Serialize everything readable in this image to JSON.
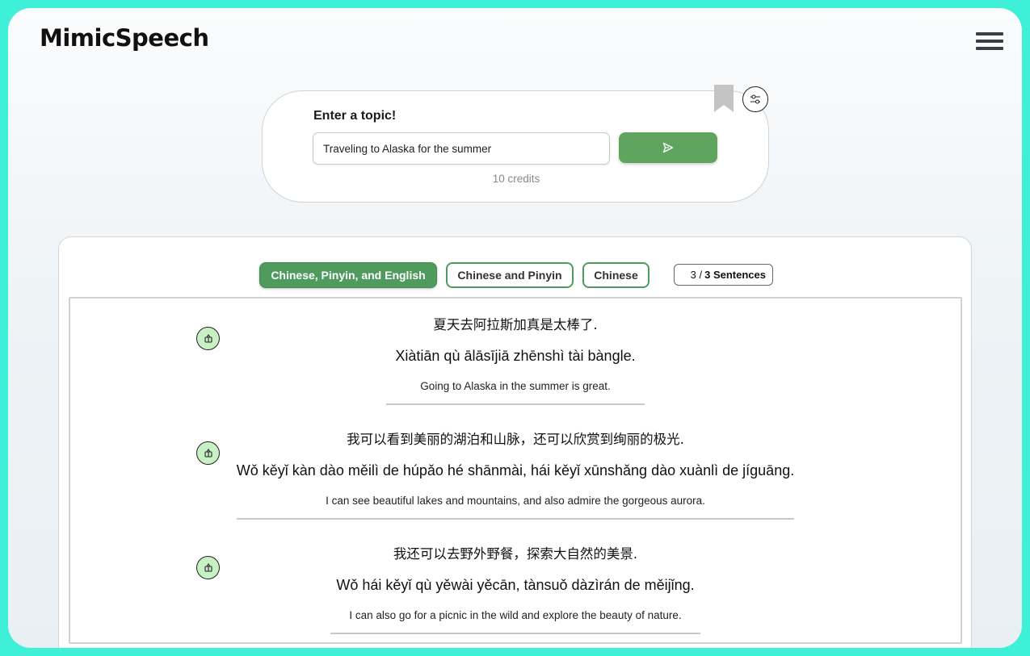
{
  "app": {
    "title": "MimicSpeech"
  },
  "header": {
    "menu_icon": "hamburger-icon"
  },
  "topic": {
    "label": "Enter a topic!",
    "input_value": "Traveling to Alaska for the summer",
    "send_icon": "send-icon",
    "credits": "10 credits",
    "bookmark_icon": "bookmark-icon",
    "settings_icon": "sliders-icon"
  },
  "tabs": [
    {
      "label": "Chinese, Pinyin, and English",
      "active": true
    },
    {
      "label": "Chinese and Pinyin",
      "active": false
    },
    {
      "label": "Chinese",
      "active": false
    }
  ],
  "sentence_count": {
    "current": "3 /",
    "total": "3 Sentences"
  },
  "sentences": [
    {
      "chinese": "夏天去阿拉斯加真是太棒了.",
      "pinyin": "Xiàtiān qù ālāsījiā zhēnshì tài bàngle.",
      "english": "Going to Alaska in the summer is great."
    },
    {
      "chinese": "我可以看到美丽的湖泊和山脉，还可以欣赏到绚丽的极光.",
      "pinyin": "Wǒ kěyǐ kàn dào měilì de húpǎo hé shānmài, hái kěyǐ xūnshǎng dào xuànlì de jíguāng.",
      "english": "I can see beautiful lakes and mountains, and also admire the gorgeous aurora."
    },
    {
      "chinese": "我还可以去野外野餐，探索大自然的美景.",
      "pinyin": "Wǒ hái kěyǐ qù yěwài yěcān, tànsuǒ dàzìrán de měijǐng.",
      "english": "I can also go for a picnic in the wild and explore the beauty of nature."
    }
  ],
  "colors": {
    "accent": "#4e9b5d",
    "frame": "#3ef0d8",
    "play_bg": "#c7f0c4"
  }
}
